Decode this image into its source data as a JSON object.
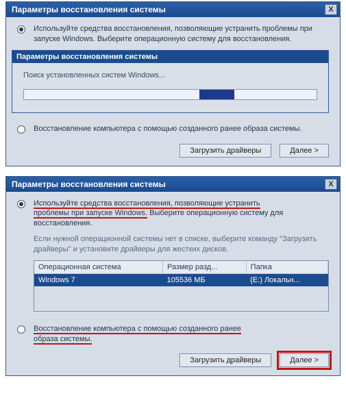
{
  "dialog1": {
    "title": "Параметры восстановления системы",
    "close": "X",
    "option1": "Используйте средства восстановления, позволяющие устранить проблемы при запуске Windows. Выберите операционную систему для восстановления.",
    "inner": {
      "title": "Параметры восстановления системы",
      "searching": "Поиск установленных систем Windows..."
    },
    "option2": "Восстановление компьютера с помощью созданного ранее образа системы.",
    "btnLoad": "Загрузить драйверы",
    "btnNext": "Далее >"
  },
  "dialog2": {
    "title": "Параметры восстановления системы",
    "close": "X",
    "opt1a": "Используйте средства восстановления, позволяющие устранить",
    "opt1b": "проблемы при запуске Windows.",
    "opt1rest": " Выберите операционную систему для восстановления.",
    "hint": "Если нужной операционной системы нет в списке, выберите команду \"Загрузить драйверы\" и установите драйверы для жестких дисков.",
    "table": {
      "col1": "Операционная система",
      "col2": "Размер разд...",
      "col3": "Папка",
      "row": {
        "os": "Windows 7",
        "size": "105536 МБ",
        "folder": "(E:) Локальн..."
      }
    },
    "opt2a": "Восстановление компьютера с помощью созданного ранее",
    "opt2b": "образа системы.",
    "btnLoad": "Загрузить драйверы",
    "btnNext": "Далее >"
  }
}
